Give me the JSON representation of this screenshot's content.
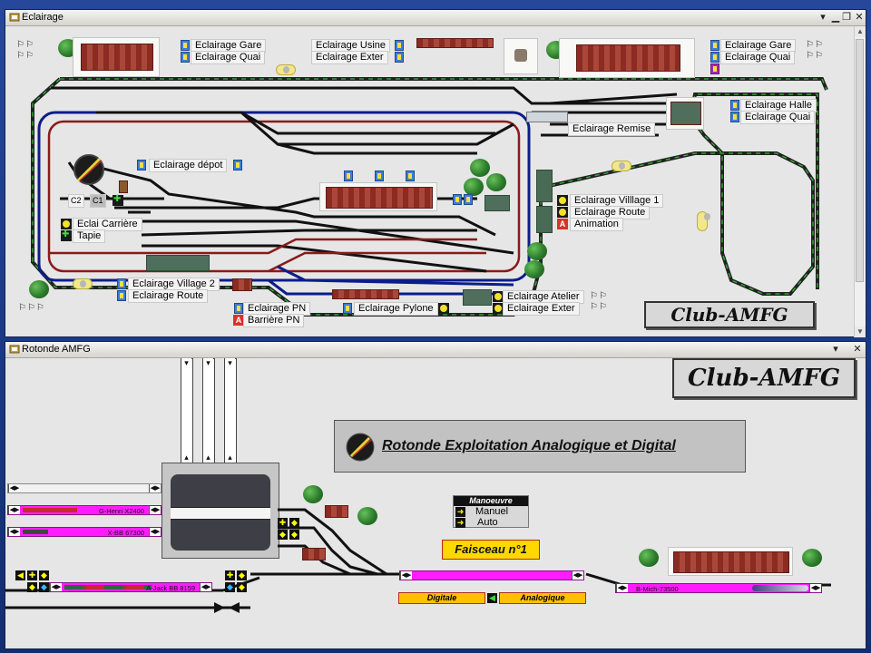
{
  "top_window": {
    "title": "Eclairage",
    "buttons": {
      "menu": "▾",
      "minimize": "▁",
      "restore": "❐",
      "close": "✕"
    },
    "labels": {
      "gare_left": "Eclairage Gare",
      "quai_left": "Eclairage Quai",
      "usine": "Eclairage Usine",
      "exter_top": "Eclairage Exter",
      "gare_right": "Eclairage Gare",
      "quai_right": "Eclairage Quai",
      "halle": "Eclairage Halle",
      "quai_halle": "Eclairage Quai",
      "remise": "Eclairage Remise",
      "depot": "Eclairage dépot",
      "village1": "Eclairage Villlage 1",
      "route_right": "Eclairage Route",
      "animation": "Animation",
      "carriere": "Eclai Carrière",
      "tapie": "Tapie",
      "village2": "Eclairage Village 2",
      "route_left": "Eclairage Route",
      "pn": "Eclairage PN",
      "barriere": "Barrière PN",
      "pylone": "Eclairage Pylone",
      "atelier": "Eclairage Atelier",
      "exter_bottom": "Eclairage Exter",
      "c2": "C2",
      "c1": "C1"
    },
    "flags": "⚐⚐",
    "flags3": "⚐⚐⚐",
    "logo": "Club-AMFG"
  },
  "bottom_window": {
    "title": "Rotonde AMFG",
    "buttons": {
      "menu": "▾",
      "close": "✕"
    },
    "logo": "Club-AMFG",
    "banner": "Rotonde Exploitation Analogique et Digital",
    "manoeuvre": {
      "header": "Manoeuvre",
      "manuel": "Manuel",
      "auto": "Auto"
    },
    "faisceau": "Faisceau n°1",
    "digitale": "Digitale",
    "analogique": "Analogique",
    "tracks": {
      "t1": "",
      "t2": "G-Henri X2400",
      "t3": "X-BB 67300",
      "t4": "A-Jack BB 8159",
      "t5": "B-Mich-73500"
    }
  }
}
